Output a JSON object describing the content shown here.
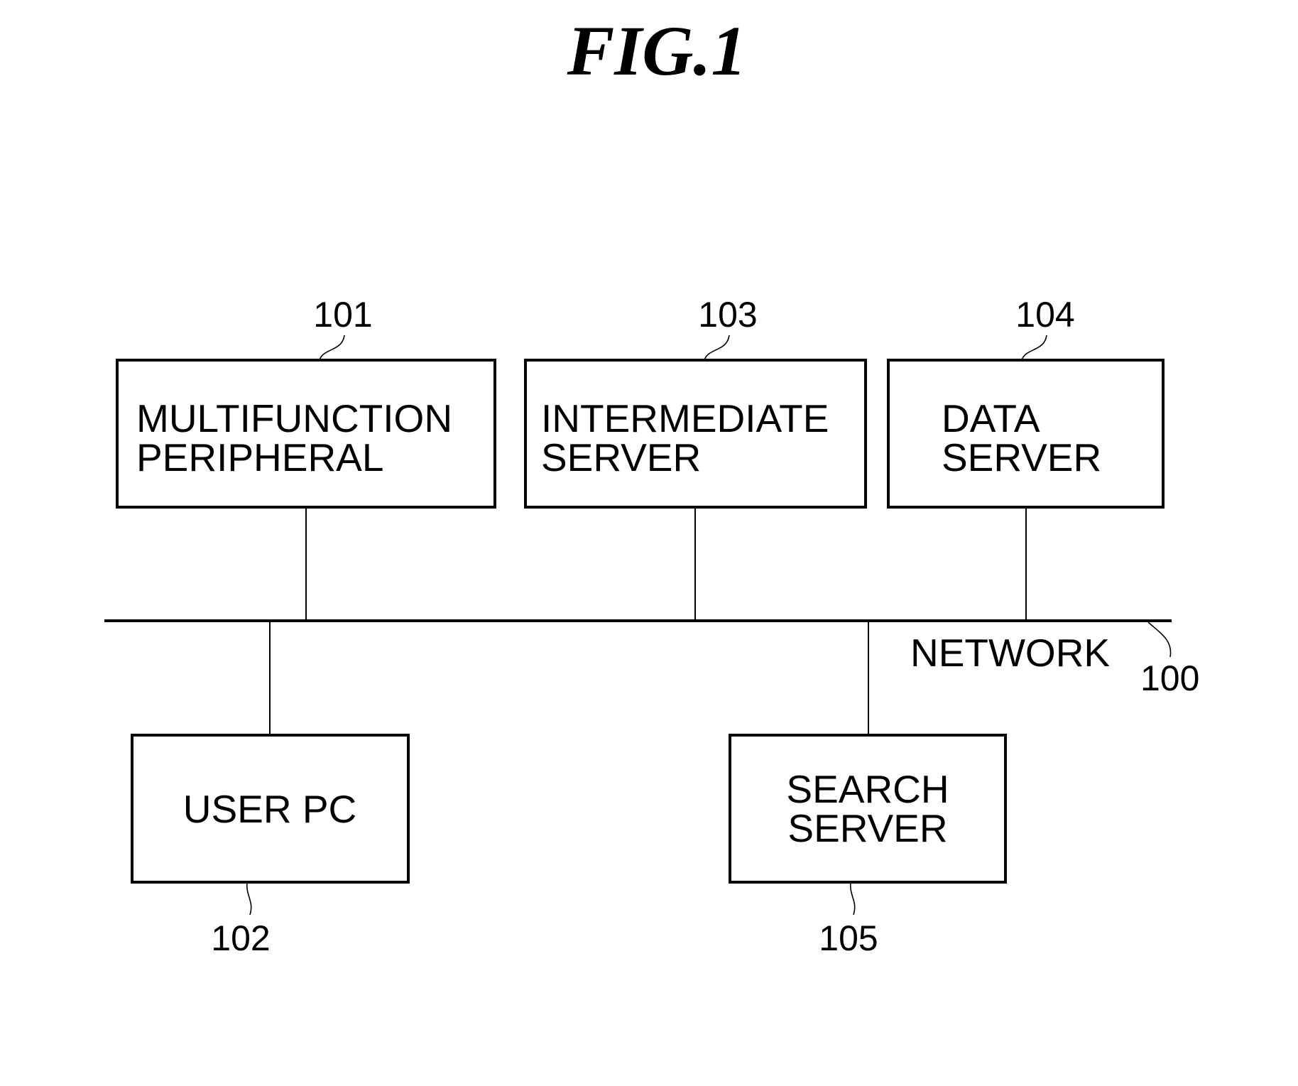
{
  "figure": {
    "title": "FIG.1"
  },
  "network": {
    "label": "NETWORK",
    "ref": "100"
  },
  "nodes": [
    {
      "ref": "101",
      "lines": [
        "MULTIFUNCTION",
        "PERIPHERAL"
      ]
    },
    {
      "ref": "103",
      "lines": [
        "INTERMEDIATE",
        "SERVER"
      ]
    },
    {
      "ref": "104",
      "lines": [
        "DATA",
        "SERVER"
      ]
    },
    {
      "ref": "102",
      "lines": [
        "USER PC"
      ]
    },
    {
      "ref": "105",
      "lines": [
        "SEARCH",
        "SERVER"
      ]
    }
  ]
}
